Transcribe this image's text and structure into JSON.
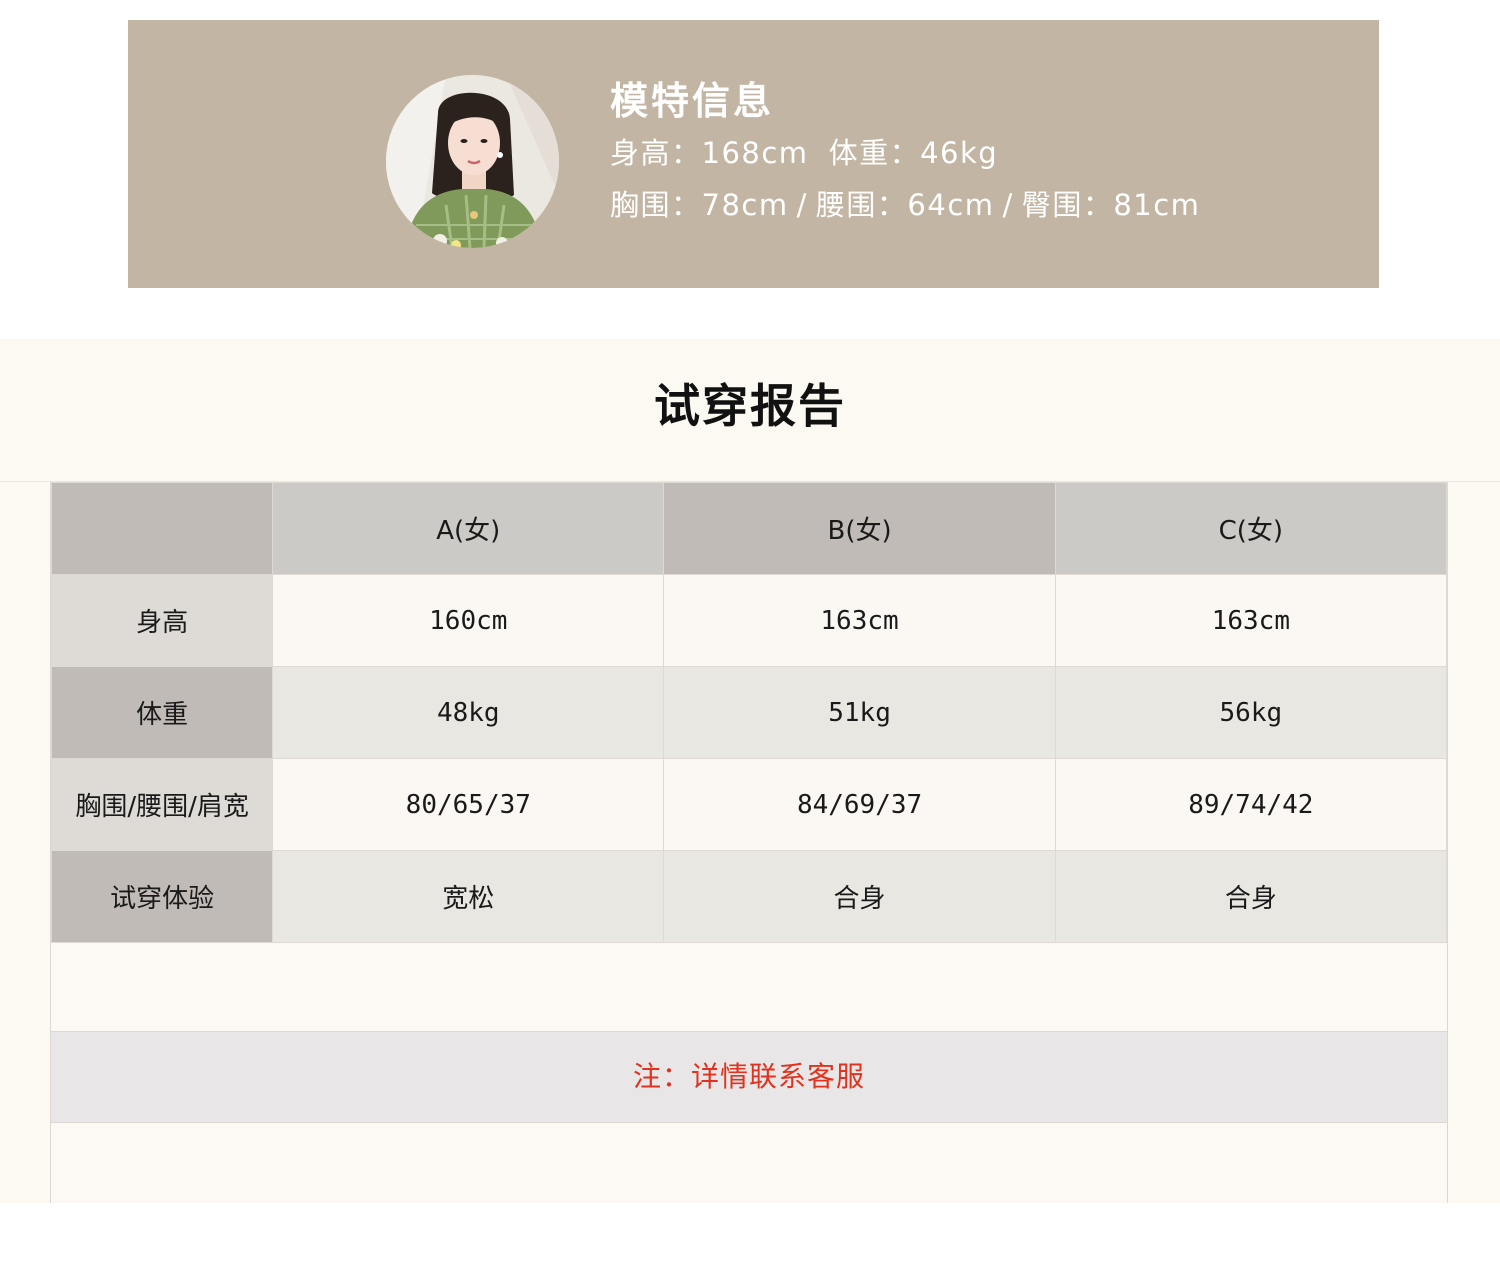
{
  "model": {
    "title": "模特信息",
    "height_label": "身高：",
    "height_value": "168cm",
    "weight_label": "体重：",
    "weight_value": "46kg",
    "bust_label": "胸围：",
    "bust_value": "78cm",
    "waist_label": "腰围：",
    "waist_value": "64cm",
    "hip_label": "臀围：",
    "hip_value": "81cm",
    "separator": "/"
  },
  "report": {
    "title": "试穿报告",
    "columns": [
      "A(女)",
      "B(女)",
      "C(女)"
    ],
    "rows": [
      {
        "label": "身高",
        "values": [
          "160cm",
          "163cm",
          "163cm"
        ]
      },
      {
        "label": "体重",
        "values": [
          "48kg",
          "51kg",
          "56kg"
        ]
      },
      {
        "label": "胸围/腰围/肩宽",
        "values": [
          "80/65/37",
          "84/69/37",
          "89/74/42"
        ]
      },
      {
        "label": "试穿体验",
        "values": [
          "宽松",
          "合身",
          "合身"
        ]
      }
    ],
    "note": "注：详情联系客服"
  },
  "colors": {
    "banner_bg": "#c2b5a3",
    "section_bg": "#fcf8f2",
    "note_text": "#e0321e",
    "header_dark": "#c0bbb6",
    "header_light": "#cbcac6"
  },
  "icons": {
    "avatar": "model-portrait"
  }
}
